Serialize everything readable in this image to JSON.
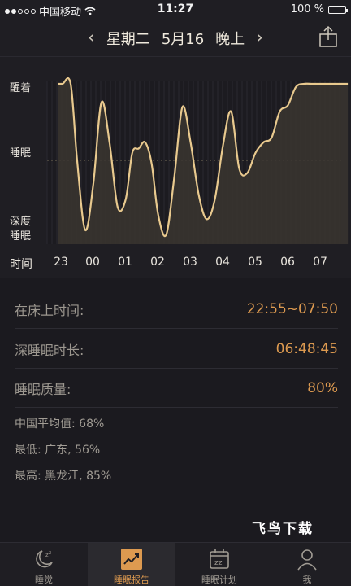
{
  "status_bar": {
    "carrier": "中国移动",
    "time": "11:27",
    "battery": "100 %",
    "battery_level": 1.0
  },
  "header": {
    "weekday": "星期二",
    "date": "5月16",
    "period": "晚上",
    "prev_icon": "chevron-left-icon",
    "next_icon": "chevron-right-icon",
    "share_icon": "share-icon"
  },
  "chart_data": {
    "type": "line",
    "y_levels": [
      "醒着",
      "睡眠",
      "深度\n睡眠"
    ],
    "y_labels": {
      "awake": "醒着",
      "sleep": "睡眠",
      "deep": "深度睡眠",
      "deep_line1": "深度",
      "deep_line2": "睡眠"
    },
    "x_title": "时间",
    "x": [
      22.9,
      23.05,
      23.3,
      23.5,
      23.75,
      0.0,
      0.25,
      0.5,
      0.75,
      1.0,
      1.2,
      1.4,
      1.6,
      1.8,
      2.0,
      2.25,
      2.5,
      2.75,
      3.0,
      3.25,
      3.5,
      3.75,
      4.0,
      4.25,
      4.5,
      4.75,
      5.0,
      5.25,
      5.5,
      5.75,
      6.0,
      6.25,
      6.5,
      6.75,
      7.0,
      7.25,
      7.5,
      7.85
    ],
    "x_hours_display": [
      "23",
      "00",
      "01",
      "02",
      "03",
      "04",
      "05",
      "06",
      "07"
    ],
    "y": [
      1.0,
      1.0,
      1.0,
      0.5,
      0.05,
      0.35,
      0.88,
      0.62,
      0.2,
      0.25,
      0.55,
      0.58,
      0.62,
      0.48,
      0.15,
      0.02,
      0.4,
      0.85,
      0.62,
      0.28,
      0.12,
      0.25,
      0.6,
      0.82,
      0.45,
      0.42,
      0.55,
      0.62,
      0.65,
      0.82,
      0.86,
      0.98,
      1.0,
      1.0,
      1.0,
      1.0,
      1.0,
      1.0
    ],
    "y_range": [
      0,
      1
    ],
    "line_color": "#e8c98e",
    "fill_color": "#3a3530"
  },
  "info": {
    "bed_time_label": "在床上时间:",
    "bed_time_value": "22:55~07:50",
    "deep_sleep_label": "深睡眠时长:",
    "deep_sleep_value": "06:48:45",
    "quality_label": "睡眠质量:",
    "quality_value": "80%"
  },
  "stats": {
    "national_avg": "中国平均值: 68%",
    "lowest": "最低: 广东, 56%",
    "highest": "最高: 黑龙江, 85%"
  },
  "watermark": "飞鸟下载",
  "tabs": [
    {
      "label": "睡觉",
      "icon": "moon-sleep-icon",
      "active": false
    },
    {
      "label": "睡眠报告",
      "icon": "report-chart-icon",
      "active": true
    },
    {
      "label": "睡眠计划",
      "icon": "calendar-sleep-icon",
      "active": false
    },
    {
      "label": "我",
      "icon": "user-icon",
      "active": false
    }
  ],
  "colors": {
    "accent": "#dd9a50",
    "background": "#1b1a1f"
  }
}
